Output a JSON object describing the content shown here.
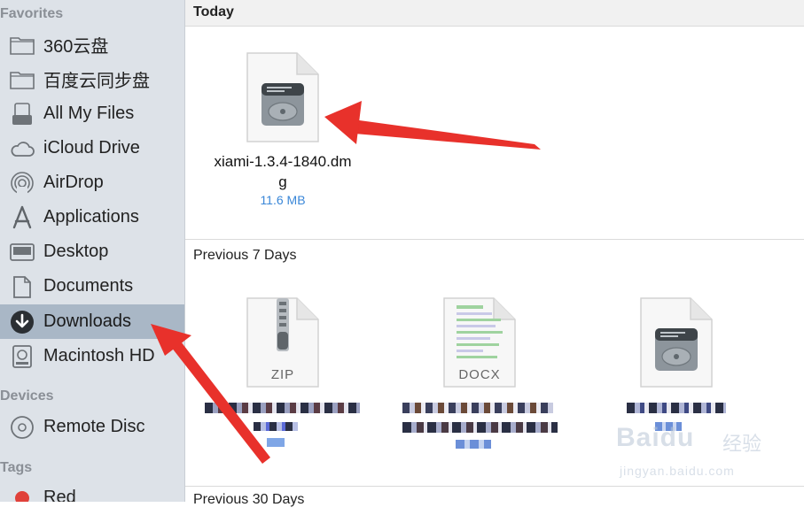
{
  "sidebar": {
    "favorites_title": "Favorites",
    "items": [
      {
        "label": "360云盘",
        "icon": "folder-icon"
      },
      {
        "label": "百度云同步盘",
        "icon": "folder-icon"
      },
      {
        "label": "All My Files",
        "icon": "all-files-icon"
      },
      {
        "label": "iCloud Drive",
        "icon": "cloud-icon"
      },
      {
        "label": "AirDrop",
        "icon": "airdrop-icon"
      },
      {
        "label": "Applications",
        "icon": "applications-icon"
      },
      {
        "label": "Desktop",
        "icon": "desktop-icon"
      },
      {
        "label": "Documents",
        "icon": "documents-icon"
      },
      {
        "label": "Downloads",
        "icon": "downloads-icon",
        "selected": true
      },
      {
        "label": "Macintosh HD",
        "icon": "hard-drive-icon"
      }
    ],
    "devices_title": "Devices",
    "devices": [
      {
        "label": "Remote Disc",
        "icon": "disc-icon"
      }
    ],
    "tags_title": "Tags",
    "tags": [
      {
        "label": "Red",
        "color": "#e0413a"
      }
    ]
  },
  "main": {
    "groups": [
      {
        "title": "Today",
        "files": [
          {
            "name_line1": "xiami-1.3.4-1840.dm",
            "name_line2": "g",
            "size": "11.6 MB",
            "icon": "dmg-file-icon"
          }
        ]
      },
      {
        "title": "Previous 7 Days",
        "files": [
          {
            "badge": "ZIP",
            "icon": "zip-file-icon"
          },
          {
            "badge": "DOCX",
            "icon": "docx-file-icon"
          },
          {
            "badge": "",
            "icon": "dmg-file-icon"
          }
        ]
      },
      {
        "title": "Previous 30 Days"
      }
    ]
  },
  "watermark": {
    "logo": "Baidu",
    "text": "经验",
    "url": "jingyan.baidu.com"
  },
  "colors": {
    "sidebar_bg": "#dde2e8",
    "selection": "#a9b7c6",
    "size_text": "#3a87d8",
    "arrow": "#e8312b"
  }
}
